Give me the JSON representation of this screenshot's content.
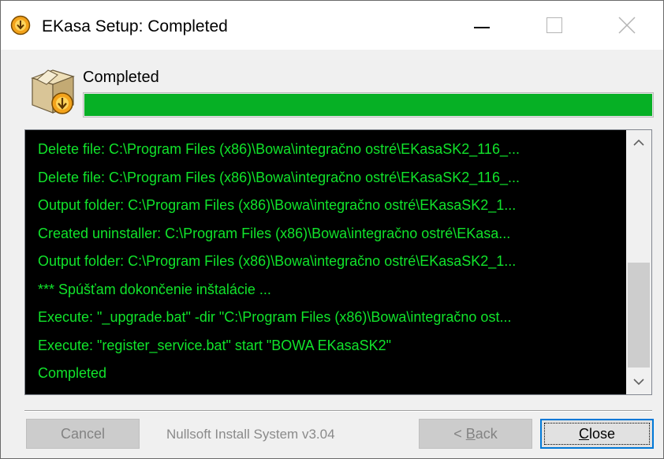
{
  "window": {
    "title": "EKasa Setup: Completed",
    "icon": "installer-icon"
  },
  "header": {
    "status": "Completed",
    "progress_fraction": 1.0,
    "progress_color": "#06b025",
    "icon": "installer-box-icon"
  },
  "log": {
    "lines": [
      "Delete file: C:\\Program Files (x86)\\Bowa\\integračno ostré\\EKasaSK2_116_...",
      "Delete file: C:\\Program Files (x86)\\Bowa\\integračno ostré\\EKasaSK2_116_...",
      "Output folder: C:\\Program Files (x86)\\Bowa\\integračno ostré\\EKasaSK2_1...",
      "Created uninstaller: C:\\Program Files (x86)\\Bowa\\integračno ostré\\EKasa...",
      "Output folder: C:\\Program Files (x86)\\Bowa\\integračno ostré\\EKasaSK2_1...",
      "*** Spúšťam dokončenie inštalácie ...",
      "Execute: \"_upgrade.bat\" -dir \"C:\\Program Files (x86)\\Bowa\\integračno ost...",
      "Execute: \"register_service.bat\" start \"BOWA EKasaSK2\"",
      "Completed"
    ],
    "text_color": "#11e42b",
    "background": "#000000"
  },
  "footer": {
    "branding": "Nullsoft Install System v3.04",
    "buttons": {
      "cancel": "Cancel",
      "back_prefix": "< ",
      "back_mnemonic": "B",
      "back_rest": "ack",
      "close_mnemonic": "C",
      "close_rest": "lose"
    }
  }
}
